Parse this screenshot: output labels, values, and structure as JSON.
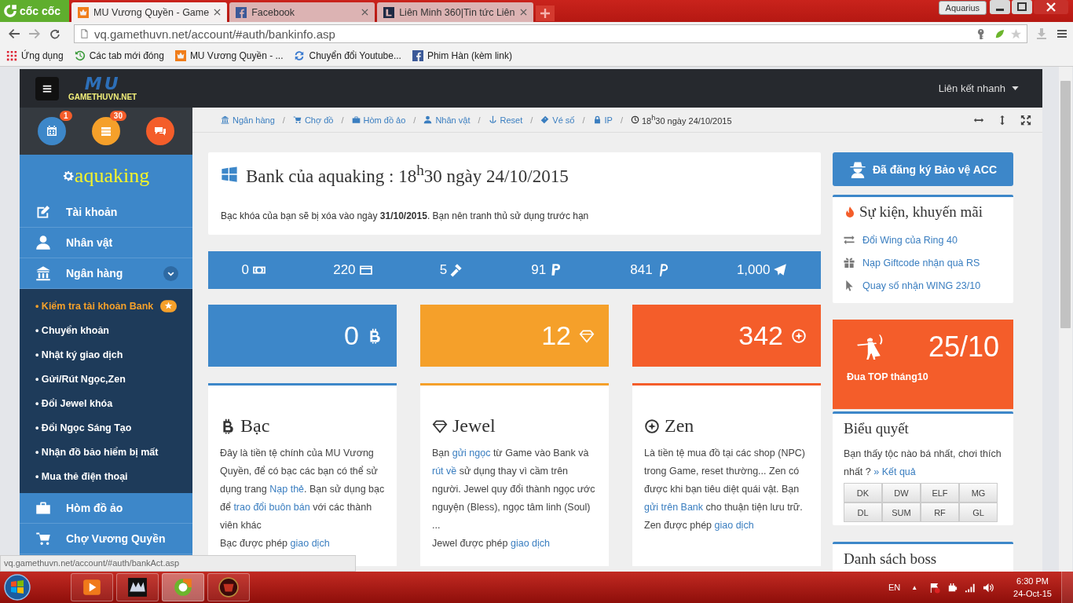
{
  "browser": {
    "brand": "cốc cốc",
    "profile": "Aquarius",
    "tabs": [
      {
        "title": "MU Vương Quyền - Game",
        "selected": true
      },
      {
        "title": "Facebook",
        "selected": false
      },
      {
        "title": "Liên Minh 360|Tin tức Liên",
        "selected": false
      }
    ],
    "url": "vq.gamethuvn.net/account/#auth/bankinfo.asp",
    "bookmarks": [
      {
        "label": "Ứng dụng"
      },
      {
        "label": "Các tab mới đóng"
      },
      {
        "label": "MU Vương Quyền - ..."
      },
      {
        "label": "Chuyển đổi Youtube..."
      },
      {
        "label": "Phim Hàn (kèm link)"
      }
    ]
  },
  "topnav": {
    "logo_big": "MU",
    "logo_small": "GAMETHUVN.NET",
    "quick_links": "Liên kết nhanh"
  },
  "sidebar": {
    "shortcuts": [
      {
        "color": "#3d87c9",
        "badge": "1"
      },
      {
        "color": "#f5a02a",
        "badge": "30"
      },
      {
        "color": "#f45d2a"
      }
    ],
    "user": "aquaking",
    "bullet": "•",
    "menu": [
      {
        "label": "Tài khoản"
      },
      {
        "label": "Nhân vật"
      },
      {
        "label": "Ngân hàng",
        "expanded": true,
        "children": [
          {
            "label": "Kiểm tra tài khoản Bank",
            "selected": true
          },
          {
            "label": "Chuyển khoản",
            "selected": false
          },
          {
            "label": "Nhật ký giao dịch",
            "selected": false
          },
          {
            "label": "Gửi/Rút Ngọc,Zen",
            "selected": false
          },
          {
            "label": "Đổi Jewel khóa",
            "selected": false
          },
          {
            "label": "Đổi Ngọc Sáng Tạo",
            "selected": false
          },
          {
            "label": "Nhận đồ bảo hiểm bị mất",
            "selected": false
          },
          {
            "label": "Mua thẻ điện thoại",
            "selected": false
          }
        ]
      },
      {
        "label": "Hòm đồ ảo"
      },
      {
        "label": "Chợ Vương Quyền"
      }
    ]
  },
  "breadcrumb": {
    "separator": "/",
    "items": [
      {
        "label": "Ngân hàng"
      },
      {
        "label": "Chợ đồ"
      },
      {
        "label": "Hòm đồ ảo"
      },
      {
        "label": "Nhân vật"
      },
      {
        "label": "Reset"
      },
      {
        "label": "Vé số"
      },
      {
        "label": "IP"
      }
    ],
    "time": "18$^{h}$30 ngày 24/10/2015"
  },
  "header": {
    "title": "Bank của aquaking : 18$^{h}$30 ngày 24/10/2015",
    "notice": "Bạc khóa của bạn sẽ bị xóa vào ngày **31/10/2015**. Bạn nên tranh thủ sử dụng trước hạn"
  },
  "stats": [
    {
      "value": "0"
    },
    {
      "value": "220"
    },
    {
      "value": "5"
    },
    {
      "value": "91"
    },
    {
      "value": "841"
    },
    {
      "value": "1,000"
    }
  ],
  "balances": [
    {
      "value": "0",
      "color": "#3d87c9"
    },
    {
      "value": "12",
      "color": "#f5a02a"
    },
    {
      "value": "342",
      "color": "#f45d2a"
    }
  ],
  "currencies": [
    {
      "title": "Bạc",
      "color": "#3d87c9",
      "paragraphs": [
        [
          {
            "text": "Đây là tiền tệ chính của MU Vương Quyền, để có bạc các bạn có thể sử dụng trang ",
            "link": false
          },
          {
            "text": "Nạp thẻ",
            "link": true
          },
          {
            "text": ". Bạn sử dụng bạc để ",
            "link": false
          },
          {
            "text": "trao đổi buôn bán",
            "link": true
          },
          {
            "text": " với các thành viên khác",
            "link": false
          }
        ],
        [
          {
            "text": "Bạc được phép ",
            "link": false
          },
          {
            "text": "giao dịch",
            "link": true
          }
        ]
      ]
    },
    {
      "title": "Jewel",
      "color": "#f5a02a",
      "paragraphs": [
        [
          {
            "text": "Bạn ",
            "link": false
          },
          {
            "text": "gửi ngọc",
            "link": true
          },
          {
            "text": " từ Game vào Bank và ",
            "link": false
          },
          {
            "text": "rút về",
            "link": true
          },
          {
            "text": " sử dụng thay vì cầm trên người. Jewel quy đổi thành ngọc ước nguyện (Bless), ngọc tâm linh (Soul) ...",
            "link": false
          }
        ],
        [
          {
            "text": "Jewel được phép ",
            "link": false
          },
          {
            "text": "giao dịch",
            "link": true
          }
        ]
      ]
    },
    {
      "title": "Zen",
      "color": "#f45d2a",
      "paragraphs": [
        [
          {
            "text": "Là tiền tệ mua đồ tại các shop (NPC) trong Game, reset thường... Zen có được khi bạn tiêu diệt quái vật. Bạn ",
            "link": false
          },
          {
            "text": "gửi trên Bank",
            "link": true
          },
          {
            "text": " cho thuận tiện lưu trữ.",
            "link": false
          }
        ],
        [
          {
            "text": "Zen được phép ",
            "link": false
          },
          {
            "text": "giao dịch",
            "link": true
          }
        ]
      ]
    }
  ],
  "protect_button": "Đã đăng ký Bảo vệ ACC",
  "events": {
    "title": "Sự kiện, khuyến mãi",
    "items": [
      {
        "label": "Đổi Wing của Ring 40"
      },
      {
        "label": "Nạp Giftcode nhận quà RS"
      },
      {
        "label": "Quay số nhận WING 23/10"
      }
    ]
  },
  "race": {
    "date": "25/10",
    "caption": "Đua TOP tháng10"
  },
  "poll": {
    "title": "Biểu quyết",
    "question": "Bạn thấy tộc nào bá nhất, chơi thích nhất ?",
    "result_link": "» Kết quả",
    "options": [
      "DK",
      "DW",
      "ELF",
      "MG",
      "DL",
      "SUM",
      "RF",
      "GL"
    ]
  },
  "boss_panel": {
    "title": "Danh sách boss"
  },
  "status_url": "vq.gamethuvn.net/account/#auth/bankAct.asp",
  "taskbar": {
    "apps": [
      {
        "selected": false
      },
      {
        "selected": false
      },
      {
        "selected": true
      },
      {
        "selected": false
      }
    ],
    "language": "EN",
    "tray_arrow": "▲",
    "time": "6:30 PM",
    "date": "24-Oct-15"
  }
}
